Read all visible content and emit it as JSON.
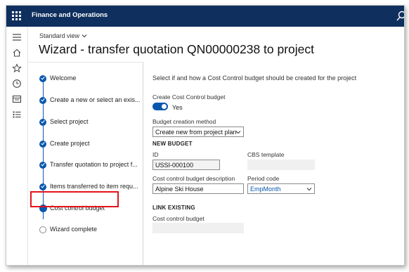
{
  "app": {
    "title": "Finance and Operations"
  },
  "header": {
    "view_label": "Standard view",
    "page_title": "Wizard - transfer quotation QN00000238 to project"
  },
  "wizard_steps": [
    {
      "label": "Welcome",
      "status": "done"
    },
    {
      "label": "Create a new or select an exis...",
      "status": "done"
    },
    {
      "label": "Select project",
      "status": "done"
    },
    {
      "label": "Create project",
      "status": "done"
    },
    {
      "label": "Transfer quotation to project f...",
      "status": "done"
    },
    {
      "label": "Items transferred to item requ...",
      "status": "done"
    },
    {
      "label": "Cost control budget",
      "status": "current"
    },
    {
      "label": "Wizard complete",
      "status": "todo"
    }
  ],
  "content": {
    "intro": "Select if and how a Cost Control budget should be created for the project",
    "create_budget_label": "Create Cost Control budget",
    "create_budget_toggle": "Yes",
    "method_label": "Budget creation method",
    "method_value": "Create new from project plan",
    "new_budget": {
      "section": "NEW BUDGET",
      "id_label": "ID",
      "id_value": "USSI-000100",
      "cbs_label": "CBS template",
      "cbs_value": "",
      "desc_label": "Cost control budget description",
      "desc_value": "Alpine Ski House",
      "period_label": "Period code",
      "period_value": "EmpMonth"
    },
    "link_existing": {
      "section": "LINK EXISTING",
      "budget_label": "Cost control budget",
      "budget_value": ""
    }
  },
  "colors": {
    "topbar": "#0f2f5e",
    "accent": "#0a58ad",
    "highlight": "#e3131b"
  }
}
